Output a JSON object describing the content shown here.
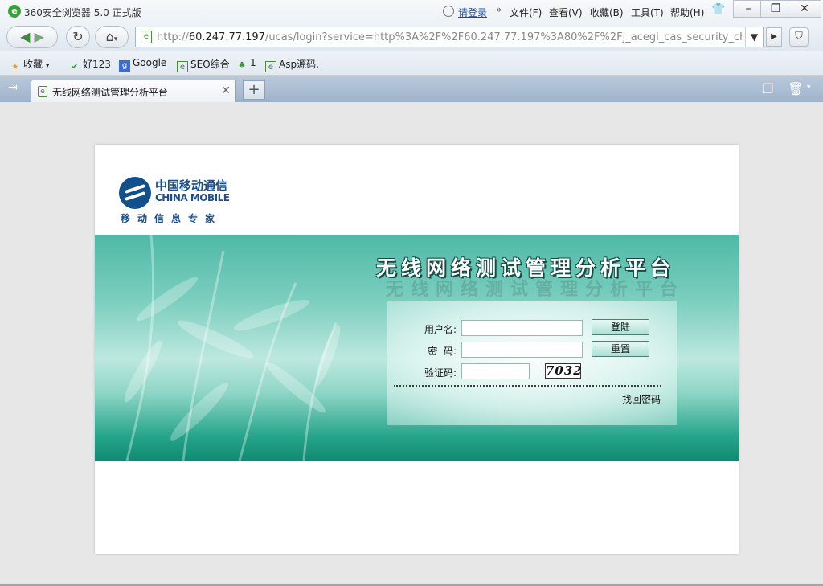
{
  "window": {
    "title": "360安全浏览器 5.0 正式版",
    "login_link": "请登录",
    "menus": [
      "文件(F)",
      "查看(V)",
      "收藏(B)",
      "工具(T)",
      "帮助(H)"
    ],
    "controls": {
      "minimize": "–",
      "restore": "❐",
      "close": "✕"
    }
  },
  "navbar": {
    "url_prefix": "http://",
    "url_host": "60.247.77.197",
    "url_rest": "/ucas/login?service=http%3A%2F%2F60.247.77.197%3A80%2F%2Fj_acegi_cas_security_check%"
  },
  "bookmarks": [
    {
      "label": "收藏",
      "icon": "star-icon"
    },
    {
      "label": "好123",
      "icon": "hao123-icon"
    },
    {
      "label": "Google",
      "icon": "google-icon"
    },
    {
      "label": "SEO综合",
      "icon": "page-icon"
    },
    {
      "label": "1",
      "icon": "user-icon"
    },
    {
      "label": "Asp源码,",
      "icon": "page-icon"
    }
  ],
  "tabs": [
    {
      "title": "无线网络测试管理分析平台",
      "active": true
    }
  ],
  "logo": {
    "cn": "中国移动通信",
    "en": "CHINA MOBILE",
    "slogan": "移动信息专家",
    "color": "#1b4e8a"
  },
  "login": {
    "banner_title": "无线网络测试管理分析平台",
    "username_label": "用户名:",
    "username_value": "",
    "password_label": "密  码:",
    "password_value": "",
    "captcha_label": "验证码:",
    "captcha_value": "",
    "captcha_image_text": "7032",
    "login_button": "登陆",
    "reset_button": "重置",
    "forgot_link": "找回密码"
  },
  "colors": {
    "banner_teal": "#23a389",
    "banner_dark": "#118a70",
    "tab_bar": "#9eb3cb"
  }
}
